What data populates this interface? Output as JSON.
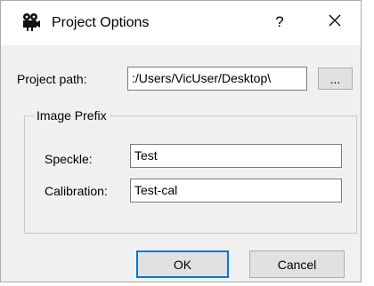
{
  "window": {
    "title": "Project Options",
    "help_label": "?",
    "app_icon": "camera-icon",
    "close_icon": "close-icon"
  },
  "project_path": {
    "label": "Project path:",
    "value": ":/Users/VicUser/Desktop\\",
    "browse_label": "..."
  },
  "image_prefix": {
    "legend": "Image Prefix",
    "speckle_label": "Speckle:",
    "speckle_value": "Test",
    "calibration_label": "Calibration:",
    "calibration_value": "Test-cal"
  },
  "buttons": {
    "ok_label": "OK",
    "cancel_label": "Cancel"
  }
}
